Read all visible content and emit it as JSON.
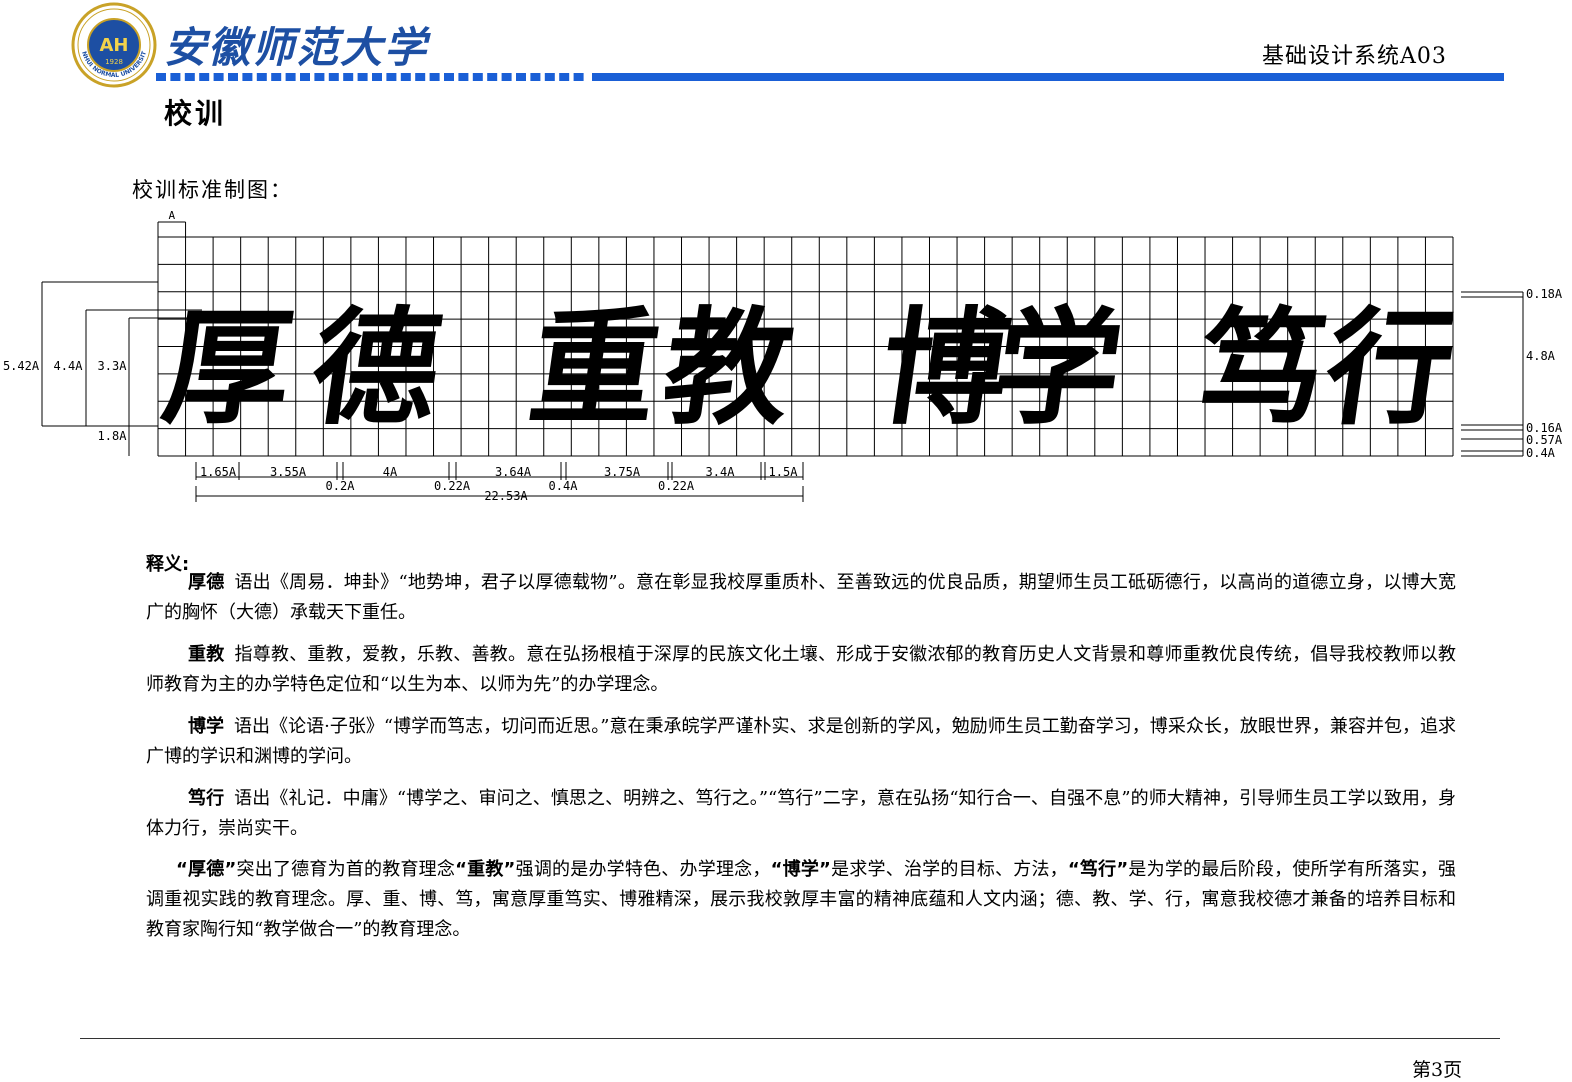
{
  "header": {
    "university_name": "安徽师范大学",
    "logo_center_text": "AH",
    "logo_ring_text": "ANHUI NORMAL UNIVERSITY",
    "logo_year": "1928",
    "doc_code": "基础设计系统A03",
    "band_color": "#1a5fd6"
  },
  "section_title": "校训",
  "figure": {
    "title": "校训标准制图：",
    "unit_label": "A",
    "characters": [
      "厚",
      "德",
      "重",
      "教",
      "博",
      "学",
      "笃",
      "行"
    ],
    "left_dims": [
      "5.42A",
      "4.4A",
      "3.3A",
      "1.8A"
    ],
    "right_dims": [
      "0.18A",
      "4.8A",
      "0.16A",
      "0.57A",
      "0.4A"
    ],
    "bottom_dims": [
      "1.65A",
      "3.55A",
      "4A",
      "3.64A",
      "3.75A",
      "3.4A",
      "1.5A"
    ],
    "gap_dims": [
      "0.2A",
      "0.22A",
      "0.4A",
      "0.22A"
    ],
    "total_dim": "22.53A"
  },
  "explanation": {
    "label": "释义:",
    "items": [
      {
        "term": "厚德",
        "text": "语出《周易．坤卦》“地势坤，君子以厚德载物”。意在彰显我校厚重质朴、至善致远的优良品质，期望师生员工砥砺德行，以高尚的道德立身，以博大宽广的胸怀（大德）承载天下重任。"
      },
      {
        "term": "重教",
        "text": "指尊教、重教，爱教，乐教、善教。意在弘扬根植于深厚的民族文化土壤、形成于安徽浓郁的教育历史人文背景和尊师重教优良传统，倡导我校教师以教师教育为主的办学特色定位和“以生为本、以师为先”的办学理念。"
      },
      {
        "term": "博学",
        "text": "语出《论语·子张》“博学而笃志，切问而近思。”意在秉承皖学严谨朴实、求是创新的学风，勉励师生员工勤奋学习，博采众长，放眼世界，兼容并包，追求广博的学识和渊博的学问。"
      },
      {
        "term": "笃行",
        "text": "语出《礼记．中庸》“博学之、审问之、慎思之、明辨之、笃行之。”“笃行”二字，意在弘扬“知行合一、自强不息”的师大精神，引导师生员工学以致用，身体力行，崇尚实干。"
      }
    ],
    "summary": {
      "k1": "“厚德”",
      "t1": "突出了德育为首的教育理念",
      "k2": "“重教”",
      "t2": "强调的是办学特色、办学理念，",
      "k3": "“博学”",
      "t3": "是求学、治学的目标、方法，",
      "k4": "“笃行”",
      "t4": "是为学的最后阶段，使所学有所落实，强调重视实践的教育理念。厚、重、博、笃，寓意厚重笃实、博雅精深，展示我校敦厚丰富的精神底蕴和人文内涵；德、教、学、行，寓意我校德才兼备的培养目标和教育家陶行知“教学做合一”的教育理念。"
    }
  },
  "footer": {
    "page_number": "第3页"
  }
}
